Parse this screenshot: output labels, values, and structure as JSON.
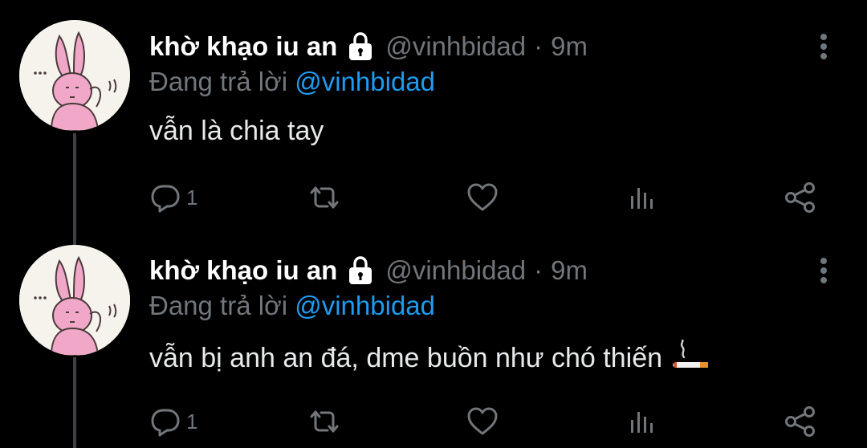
{
  "colors": {
    "background": "#000000",
    "primary_text": "#e7e9ea",
    "secondary_text": "#71767b",
    "link": "#1d9bf0"
  },
  "tweets": [
    {
      "display_name": "khờ khạo iu an",
      "handle": "@vinhbidad",
      "separator": "·",
      "time": "9m",
      "replying_prefix": "Đang trả lời",
      "replying_to": "@vinhbidad",
      "text": "vẫn là chia tay",
      "emoji": "",
      "reply_count": "1",
      "icons": [
        "lock-icon",
        "more-icon",
        "reply-icon",
        "retweet-icon",
        "like-icon",
        "views-icon",
        "share-icon"
      ]
    },
    {
      "display_name": "khờ khạo iu an",
      "handle": "@vinhbidad",
      "separator": "·",
      "time": "9m",
      "replying_prefix": "Đang trả lời",
      "replying_to": "@vinhbidad",
      "text": "vẫn bị anh an đá, dme buồn như chó thiến",
      "emoji": "cigarette-icon",
      "reply_count": "1",
      "icons": [
        "lock-icon",
        "more-icon",
        "reply-icon",
        "retweet-icon",
        "like-icon",
        "views-icon",
        "share-icon"
      ]
    }
  ]
}
